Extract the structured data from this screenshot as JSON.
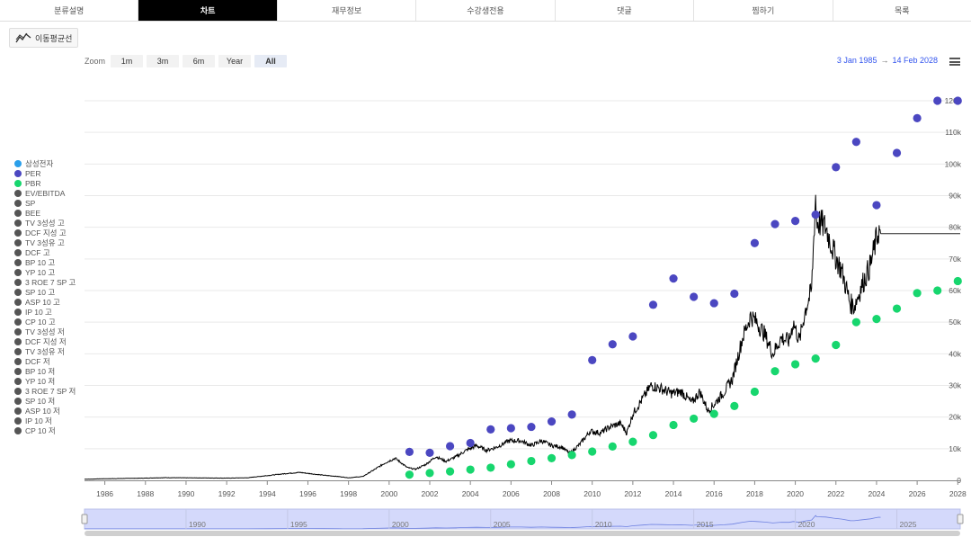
{
  "tabs": [
    {
      "label": "분류설명",
      "active": false
    },
    {
      "label": "차트",
      "active": true
    },
    {
      "label": "재무정보",
      "active": false
    },
    {
      "label": "수강생전용",
      "active": false
    },
    {
      "label": "댓글",
      "active": false
    },
    {
      "label": "찜하기",
      "active": false
    },
    {
      "label": "목록",
      "active": false
    }
  ],
  "moving_average_button": {
    "label": "이동평균선",
    "icon": "trend-line-icon"
  },
  "zoom": {
    "label": "Zoom",
    "buttons": [
      "1m",
      "3m",
      "6m",
      "Year",
      "All"
    ],
    "selected": "All"
  },
  "range": {
    "from": "3 Jan 1985",
    "arrow": "→",
    "to": "14 Feb 2028"
  },
  "menu": {
    "icon": "hamburger-icon"
  },
  "colors": {
    "price": "#000000",
    "per": "#4b47c1",
    "pbr": "#17d66e",
    "samsung": "#2a9fea",
    "inactive": "#555555",
    "navigator_fill": "#d4d9fb",
    "grid": "#e9e9e9",
    "accent_text": "#3355ee"
  },
  "legend": [
    {
      "label": "삼성전자",
      "color": "#2a9fea",
      "active": true
    },
    {
      "label": "PER",
      "color": "#4b47c1",
      "active": true
    },
    {
      "label": "PBR",
      "color": "#17d66e",
      "active": true
    },
    {
      "label": "EV/EBITDA",
      "color": "#555555",
      "active": false
    },
    {
      "label": "SP",
      "color": "#555555",
      "active": false
    },
    {
      "label": "BEE",
      "color": "#555555",
      "active": false
    },
    {
      "label": "TV 3성성 고",
      "color": "#555555",
      "active": false
    },
    {
      "label": "DCF 지성 고",
      "color": "#555555",
      "active": false
    },
    {
      "label": "TV 3성유 고",
      "color": "#555555",
      "active": false
    },
    {
      "label": "DCF 고",
      "color": "#555555",
      "active": false
    },
    {
      "label": "BP 10 고",
      "color": "#555555",
      "active": false
    },
    {
      "label": "YP 10 고",
      "color": "#555555",
      "active": false
    },
    {
      "label": "3 ROE 7 SP 고",
      "color": "#555555",
      "active": false
    },
    {
      "label": "SP 10 고",
      "color": "#555555",
      "active": false
    },
    {
      "label": "ASP 10 고",
      "color": "#555555",
      "active": false
    },
    {
      "label": "IP 10 고",
      "color": "#555555",
      "active": false
    },
    {
      "label": "CP 10 고",
      "color": "#555555",
      "active": false
    },
    {
      "label": "TV 3성성 저",
      "color": "#555555",
      "active": false
    },
    {
      "label": "DCF 지성 저",
      "color": "#555555",
      "active": false
    },
    {
      "label": "TV 3성유 저",
      "color": "#555555",
      "active": false
    },
    {
      "label": "DCF 저",
      "color": "#555555",
      "active": false
    },
    {
      "label": "BP 10 저",
      "color": "#555555",
      "active": false
    },
    {
      "label": "YP 10 저",
      "color": "#555555",
      "active": false
    },
    {
      "label": "3 ROE 7 SP 저",
      "color": "#555555",
      "active": false
    },
    {
      "label": "SP 10 저",
      "color": "#555555",
      "active": false
    },
    {
      "label": "ASP 10 저",
      "color": "#555555",
      "active": false
    },
    {
      "label": "IP 10 저",
      "color": "#555555",
      "active": false
    },
    {
      "label": "CP 10 저",
      "color": "#555555",
      "active": false
    }
  ],
  "chart_data": {
    "type": "line",
    "title": "",
    "xlabel": "",
    "ylabel": "",
    "xlim": [
      1985,
      2028.12
    ],
    "ylim": [
      0,
      120000
    ],
    "x_ticks": [
      "1986",
      "1988",
      "1990",
      "1992",
      "1994",
      "1996",
      "1998",
      "2000",
      "2002",
      "2004",
      "2006",
      "2008",
      "2010",
      "2012",
      "2014",
      "2016",
      "2018",
      "2020",
      "2022",
      "2024",
      "2026",
      "2028"
    ],
    "y_ticks": [
      "0",
      "10k",
      "20k",
      "30k",
      "40k",
      "50k",
      "60k",
      "70k",
      "80k",
      "90k",
      "100k",
      "110k",
      "120k"
    ],
    "y_tick_values": [
      0,
      10000,
      20000,
      30000,
      40000,
      50000,
      60000,
      70000,
      80000,
      90000,
      100000,
      110000,
      120000
    ],
    "grid": true,
    "legend_position": "left",
    "last_price": 78000,
    "series": [
      {
        "name": "삼성전자",
        "kind": "price-line",
        "points": [
          [
            1985.0,
            350
          ],
          [
            1986.0,
            500
          ],
          [
            1987.0,
            600
          ],
          [
            1988.0,
            700
          ],
          [
            1989.0,
            850
          ],
          [
            1990.0,
            800
          ],
          [
            1991.0,
            750
          ],
          [
            1992.0,
            700
          ],
          [
            1993.0,
            800
          ],
          [
            1994.0,
            1500
          ],
          [
            1995.0,
            2200
          ],
          [
            1995.6,
            2500
          ],
          [
            1996.0,
            2200
          ],
          [
            1996.8,
            1600
          ],
          [
            1997.5,
            1200
          ],
          [
            1998.0,
            800
          ],
          [
            1998.7,
            1200
          ],
          [
            1999.3,
            3500
          ],
          [
            1999.8,
            5500
          ],
          [
            2000.3,
            7000
          ],
          [
            2000.9,
            4000
          ],
          [
            2001.3,
            3500
          ],
          [
            2001.8,
            5000
          ],
          [
            2002.3,
            7500
          ],
          [
            2002.8,
            6000
          ],
          [
            2003.3,
            7500
          ],
          [
            2003.8,
            9500
          ],
          [
            2004.3,
            11000
          ],
          [
            2004.8,
            9500
          ],
          [
            2005.3,
            10500
          ],
          [
            2005.9,
            12500
          ],
          [
            2006.5,
            12500
          ],
          [
            2007.0,
            11000
          ],
          [
            2007.5,
            12500
          ],
          [
            2008.0,
            11000
          ],
          [
            2008.5,
            10500
          ],
          [
            2008.9,
            8500
          ],
          [
            2009.4,
            11500
          ],
          [
            2009.9,
            15500
          ],
          [
            2010.4,
            15000
          ],
          [
            2010.9,
            17000
          ],
          [
            2011.4,
            18000
          ],
          [
            2011.7,
            15000
          ],
          [
            2012.0,
            21000
          ],
          [
            2012.5,
            26000
          ],
          [
            2012.9,
            30000
          ],
          [
            2013.4,
            29000
          ],
          [
            2013.9,
            27500
          ],
          [
            2014.4,
            28000
          ],
          [
            2014.9,
            24500
          ],
          [
            2015.3,
            28000
          ],
          [
            2015.7,
            22000
          ],
          [
            2016.0,
            24000
          ],
          [
            2016.5,
            28000
          ],
          [
            2016.9,
            32000
          ],
          [
            2017.4,
            45000
          ],
          [
            2017.8,
            52000
          ],
          [
            2018.1,
            50000
          ],
          [
            2018.5,
            46000
          ],
          [
            2018.9,
            40000
          ],
          [
            2019.3,
            45000
          ],
          [
            2019.7,
            44000
          ],
          [
            2019.9,
            50000
          ],
          [
            2020.2,
            44000
          ],
          [
            2020.5,
            54000
          ],
          [
            2020.8,
            60000
          ],
          [
            2021.0,
            90000
          ],
          [
            2021.05,
            82000
          ],
          [
            2021.5,
            80000
          ],
          [
            2021.9,
            72000
          ],
          [
            2022.3,
            66000
          ],
          [
            2022.7,
            56000
          ],
          [
            2022.9,
            55000
          ],
          [
            2023.3,
            62000
          ],
          [
            2023.7,
            68000
          ],
          [
            2023.95,
            75000
          ],
          [
            2024.1,
            79000
          ],
          [
            2024.2,
            78000
          ]
        ]
      },
      {
        "name": "PER",
        "kind": "scatter",
        "points": [
          [
            2001.0,
            9000
          ],
          [
            2002.0,
            8700
          ],
          [
            2003.0,
            10800
          ],
          [
            2004.0,
            11800
          ],
          [
            2005.0,
            16100
          ],
          [
            2006.0,
            16500
          ],
          [
            2007.0,
            16900
          ],
          [
            2008.0,
            18600
          ],
          [
            2009.0,
            20800
          ],
          [
            2010.0,
            38000
          ],
          [
            2011.0,
            43000
          ],
          [
            2012.0,
            45500
          ],
          [
            2013.0,
            55500
          ],
          [
            2014.0,
            63800
          ],
          [
            2015.0,
            58000
          ],
          [
            2016.0,
            56000
          ],
          [
            2017.0,
            59000
          ],
          [
            2018.0,
            75000
          ],
          [
            2019.0,
            81000
          ],
          [
            2020.0,
            82000
          ],
          [
            2021.0,
            84000
          ],
          [
            2022.0,
            99000
          ],
          [
            2023.0,
            107000
          ],
          [
            2024.0,
            87000
          ],
          [
            2025.0,
            103500
          ],
          [
            2026.0,
            114500
          ],
          [
            2027.0,
            120000
          ],
          [
            2028.0,
            120000
          ]
        ]
      },
      {
        "name": "PBR",
        "kind": "scatter",
        "points": [
          [
            2001.0,
            1800
          ],
          [
            2002.0,
            2300
          ],
          [
            2003.0,
            2800
          ],
          [
            2004.0,
            3400
          ],
          [
            2005.0,
            4000
          ],
          [
            2006.0,
            5100
          ],
          [
            2007.0,
            6100
          ],
          [
            2008.0,
            7000
          ],
          [
            2009.0,
            8000
          ],
          [
            2010.0,
            9100
          ],
          [
            2011.0,
            10700
          ],
          [
            2012.0,
            12200
          ],
          [
            2013.0,
            14300
          ],
          [
            2014.0,
            17500
          ],
          [
            2015.0,
            19500
          ],
          [
            2016.0,
            21000
          ],
          [
            2017.0,
            23500
          ],
          [
            2018.0,
            28000
          ],
          [
            2019.0,
            34500
          ],
          [
            2020.0,
            36700
          ],
          [
            2021.0,
            38500
          ],
          [
            2022.0,
            42800
          ],
          [
            2023.0,
            50000
          ],
          [
            2024.0,
            51000
          ],
          [
            2025.0,
            54300
          ],
          [
            2026.0,
            59200
          ],
          [
            2027.0,
            60000
          ],
          [
            2028.0,
            63000
          ]
        ]
      }
    ],
    "navigator": {
      "labels": [
        "1990",
        "1995",
        "2000",
        "2005",
        "2010",
        "2015",
        "2020",
        "2025"
      ]
    }
  }
}
